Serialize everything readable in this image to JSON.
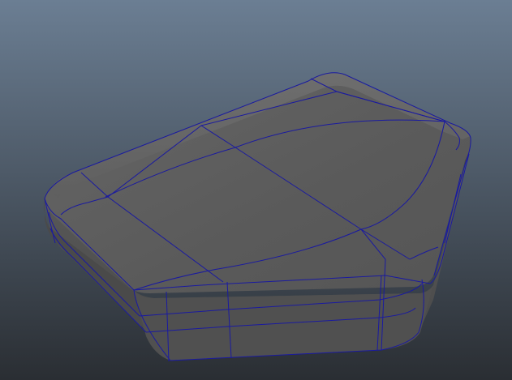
{
  "viewport": {
    "background_top": "#6b7e93",
    "background_bottom": "#2a2e33"
  },
  "mesh": {
    "object": "pentagonal-cushion-mesh",
    "top_face_color": "#5a5a5a",
    "side_face_color": "#4e4e4e",
    "wireframe_color": "#1a1aa0"
  }
}
